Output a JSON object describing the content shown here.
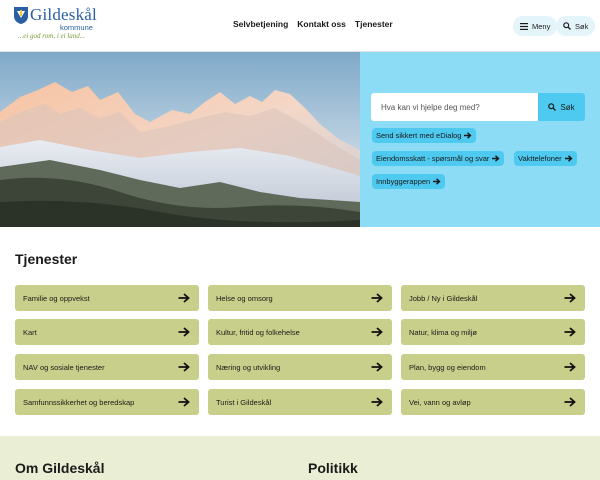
{
  "header": {
    "logo_name": "Gildeskål",
    "logo_sub": "kommune",
    "logo_slogan": "...ei god rom, i ei land...",
    "nav": [
      "Selvbetjening",
      "Kontakt oss",
      "Tjenester"
    ],
    "menu_label": "Meny",
    "search_label": "Søk"
  },
  "hero": {
    "search_placeholder": "Hva kan vi hjelpe deg med?",
    "search_button": "Søk",
    "quick_links": [
      "Send sikkert med eDialog",
      "Eiendomsskatt - spørsmål og svar",
      "Vakttelefoner",
      "Innbyggerappen"
    ]
  },
  "services": {
    "title": "Tjenester",
    "items": [
      "Familie og oppvekst",
      "Helse og omsorg",
      "Jobb / Ny i Gildeskål",
      "Kart",
      "Kultur, fritid og folkehelse",
      "Natur, klima og miljø",
      "NAV og sosiale tjenester",
      "Næring og utvikling",
      "Plan, bygg og eiendom",
      "Samfunnssikkerhet og beredskap",
      "Turist i Gildeskål",
      "Vei, vann og avløp"
    ]
  },
  "bottom": {
    "left_title": "Om Gildeskål",
    "right_title": "Politikk"
  },
  "colors": {
    "brand_blue": "#2a5fa3",
    "hero_panel": "#8ddcf5",
    "accent_cyan": "#4ec9ef",
    "tile_green": "#c8cf8a",
    "bottom_bg": "#e9eed4"
  }
}
